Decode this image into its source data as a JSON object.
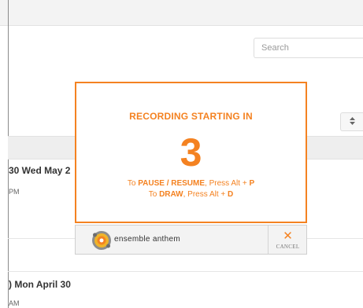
{
  "search": {
    "placeholder": "Search"
  },
  "sort_button": {
    "icon": "sort-updown-icon",
    "glyph": "⬍"
  },
  "list": {
    "rows": [
      {
        "title": "30 Wed May 2",
        "subtitle": "PM"
      },
      {
        "title": ") Mon April 30",
        "subtitle": "AM"
      }
    ]
  },
  "modal": {
    "heading": "RECORDING STARTING IN",
    "count": "3",
    "line1_prefix": "To ",
    "line1_action": "PAUSE / RESUME",
    "line1_mid": ", Press Alt + ",
    "line1_key": "P",
    "line2_prefix": "To ",
    "line2_action": "DRAW",
    "line2_mid": ", Press Alt + ",
    "line2_key": "D"
  },
  "controls": {
    "brand_name": "ensemble anthem",
    "logo_icon": "ensemble-anthem-logo",
    "cancel_label": "CANCEL",
    "cancel_icon": "close-icon"
  },
  "colors": {
    "accent": "#f48221",
    "text": "#333333",
    "muted": "#666666"
  }
}
